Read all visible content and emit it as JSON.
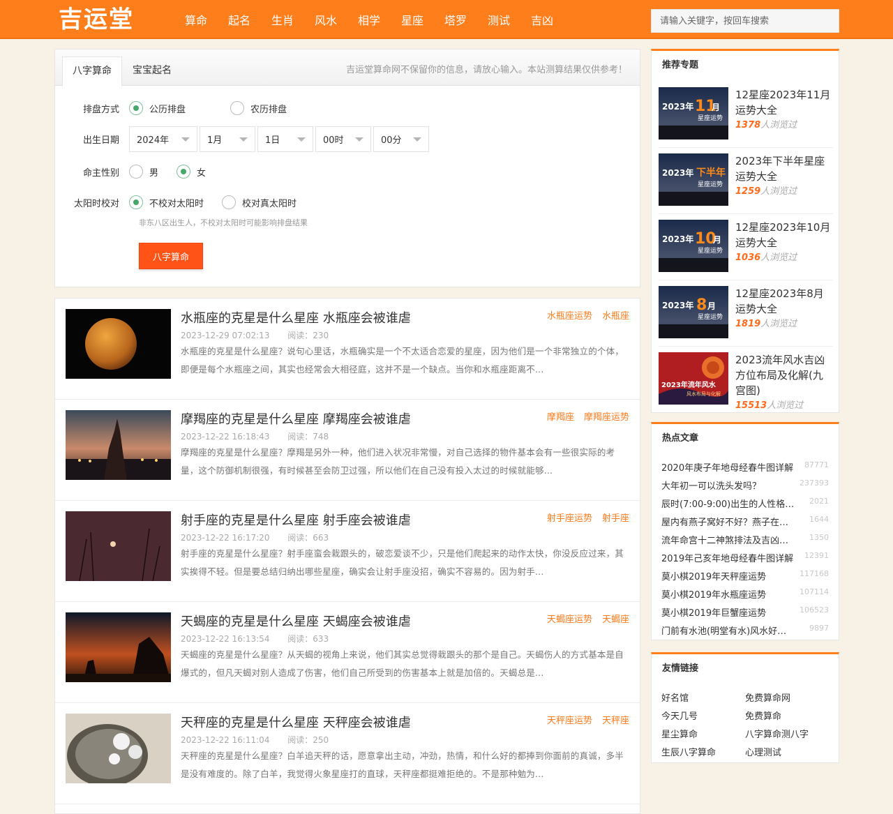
{
  "header": {
    "logo": "吉运堂",
    "nav": [
      "算命",
      "起名",
      "生肖",
      "风水",
      "相学",
      "星座",
      "塔罗",
      "测试",
      "吉凶"
    ],
    "search_placeholder": "请输入关键字，按回车搜索"
  },
  "form": {
    "tabs": [
      "八字算命",
      "宝宝起名"
    ],
    "notice": "吉运堂算命网不保留你的信息，请放心输入。本站测算结果仅供参考！",
    "rows": {
      "mode_label": "排盘方式",
      "mode_options": [
        "公历排盘",
        "农历排盘"
      ],
      "date_label": "出生日期",
      "date_values": [
        "2024年",
        "1月",
        "1日",
        "00时",
        "00分"
      ],
      "gender_label": "命主性别",
      "gender_options": [
        "男",
        "女"
      ],
      "solar_label": "太阳时校对",
      "solar_options": [
        "不校对太阳时",
        "校对真太阳时"
      ]
    },
    "hint": "非东八区出生人，不校对太阳时可能影响排盘结果",
    "submit": "八字算命"
  },
  "articles": [
    {
      "title": "水瓶座的克星是什么星座 水瓶座会被谁虐",
      "tags": [
        "水瓶座运势",
        "水瓶座"
      ],
      "date": "2023-12-29 07:02:13",
      "reads": "阅读：230",
      "desc": "水瓶座的克星是什么星座？说句心里话，水瓶确实是一个不太适合恋爱的星座，因为他们是一个非常独立的个体，即便是每个水瓶座之间，其实也经常会大相径庭，这并不是一个缺点。当你和水瓶座距离不..."
    },
    {
      "title": "摩羯座的克星是什么星座 摩羯座会被谁虐",
      "tags": [
        "摩羯座",
        "摩羯座运势"
      ],
      "date": "2023-12-22 16:18:43",
      "reads": "阅读：748",
      "desc": "摩羯座的克星是什么星座？摩羯是另外一种，他们进入状况非常慢，对自己选择的物件基本会有一些很实际的考量，这个防御机制很强，有时候甚至会防卫过强，所以他们在自己没有投入太过的时候就能够..."
    },
    {
      "title": "射手座的克星是什么星座 射手座会被谁虐",
      "tags": [
        "射手座运势",
        "射手座"
      ],
      "date": "2023-12-22 16:17:20",
      "reads": "阅读：663",
      "desc": "射手座的克星是什么星座？射手座蛮会栽跟头的，破恋爱谈不少，只是他们爬起来的动作太快，你没反应过来，其实挨得不轻。但是要总结归纳出哪些星座，确实会让射手座没招，确实不容易的。因为射手..."
    },
    {
      "title": "天蝎座的克星是什么星座 天蝎座会被谁虐",
      "tags": [
        "天蝎座运势",
        "天蝎座"
      ],
      "date": "2023-12-22 16:13:54",
      "reads": "阅读：633",
      "desc": "天蝎座的克星是什么星座？从天蝎的视角上来说，他们其实总觉得栽跟头的那个是自己。天蝎伤人的方式基本是自爆式的，但凡天蝎对别人造成了伤害，他们自己所受到的伤害基本上就是加倍的。天蝎总是..."
    },
    {
      "title": "天秤座的克星是什么星座 天秤座会被谁虐",
      "tags": [
        "天秤座运势",
        "天秤座"
      ],
      "date": "2023-12-22 16:11:04",
      "reads": "阅读：250",
      "desc": "天秤座的克星是什么星座？白羊追天秤的话，愿意拿出主动，冲劲，热情，和什么好的都捧到你面前的真诚，多半是没有难度的。除了白羊，我觉得火象星座打的直球，天秤座都挺难拒绝的。不是那种勉为..."
    }
  ],
  "sidebar": {
    "topics_title": "推荐专题",
    "topics": [
      {
        "title": "12星座2023年11月运势大全",
        "count": "1378",
        "unit": "人浏览过",
        "img_year": "2023年",
        "img_big": "11",
        "img_month": "月",
        "img_sub": "星座运势"
      },
      {
        "title": "2023年下半年星座运势大全",
        "count": "1259",
        "unit": "人浏览过",
        "img_year": "2023年",
        "img_big": "下半年",
        "img_month": "",
        "img_sub": "星座运势"
      },
      {
        "title": "12星座2023年10月运势大全",
        "count": "1036",
        "unit": "人浏览过",
        "img_year": "2023年",
        "img_big": "10",
        "img_month": "月",
        "img_sub": "星座运势"
      },
      {
        "title": "12星座2023年8月运势大全",
        "count": "1819",
        "unit": "人浏览过",
        "img_year": "2023年",
        "img_big": "8",
        "img_month": "月",
        "img_sub": "星座运势"
      },
      {
        "title": "2023流年风水吉凶方位布局及化解(九宫图)",
        "count": "15513",
        "unit": "人浏览过",
        "img_year": "2023年流年风水",
        "img_big": "",
        "img_month": "",
        "img_sub": "风水布局与化解"
      }
    ],
    "hot_title": "热点文章",
    "hot": [
      {
        "title": "2020年庚子年地母经春牛图详解",
        "count": "87771"
      },
      {
        "title": "大年初一可以洗头发吗？",
        "count": "237393"
      },
      {
        "title": "辰时(7:00-9:00)出生的人性格…",
        "count": "2021"
      },
      {
        "title": "屋内有燕子窝好不好？燕子在…",
        "count": "1644"
      },
      {
        "title": "流年命宫十二神煞排法及吉凶…",
        "count": "1350"
      },
      {
        "title": "2019年己亥年地母经春牛图详解",
        "count": "12391"
      },
      {
        "title": "莫小棋2019年天秤座运势",
        "count": "117168"
      },
      {
        "title": "莫小棋2019年水瓶座运势",
        "count": "107114"
      },
      {
        "title": "莫小棋2019年巨蟹座运势",
        "count": "106523"
      },
      {
        "title": "门前有水池(明堂有水)风水好…",
        "count": "9897"
      }
    ],
    "links_title": "友情链接",
    "links": [
      "好名馆",
      "免费算命网",
      "今天几号",
      "免费算命",
      "星尘算命",
      "八字算命测八字",
      "生辰八字算命",
      "心理测试"
    ]
  }
}
